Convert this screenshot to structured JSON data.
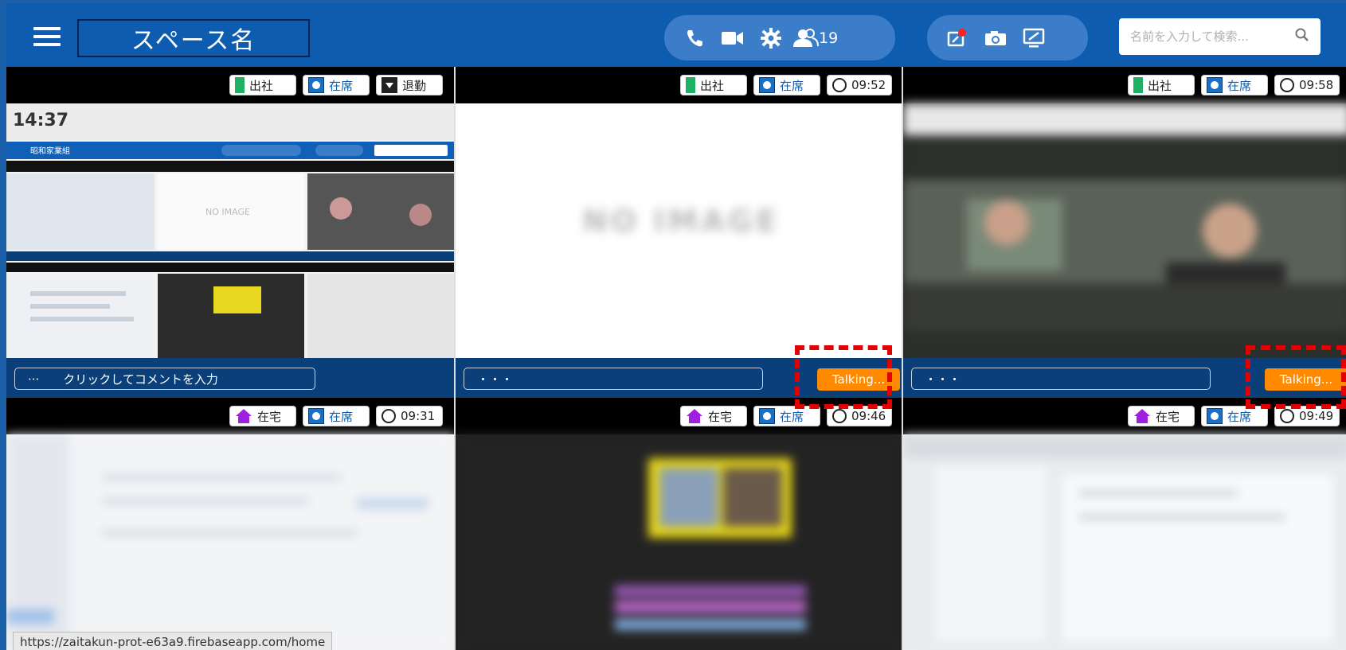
{
  "header": {
    "space_name": "スペース名",
    "participants_count": "19",
    "search_placeholder": "名前を入力して検索..."
  },
  "tiles": [
    {
      "badges": [
        "出社",
        "在席",
        "退勤"
      ],
      "comment": "···　　クリックしてコメントを入力",
      "talking": null
    },
    {
      "badges": [
        "出社",
        "在席",
        "09:52"
      ],
      "comment": "・・・",
      "talking": "Talking..."
    },
    {
      "badges": [
        "出社",
        "在席",
        "09:58"
      ],
      "comment": "・・・",
      "talking": "Talking..."
    },
    {
      "badges": [
        "在宅",
        "在席",
        "09:31"
      ]
    },
    {
      "badges": [
        "在宅",
        "在席",
        "09:46"
      ]
    },
    {
      "badges": [
        "在宅",
        "在席",
        "09:49"
      ]
    }
  ],
  "thumbnail": {
    "clock": "14:37",
    "title": "昭和家業組",
    "no_image": "NO IMAGE"
  },
  "status_url": "https://zaitakun-prot-e63a9.firebaseapp.com/home",
  "colors": {
    "header_bg": "#0d5cb0",
    "talking": "#ff8a00",
    "highlight": "#e30000"
  }
}
